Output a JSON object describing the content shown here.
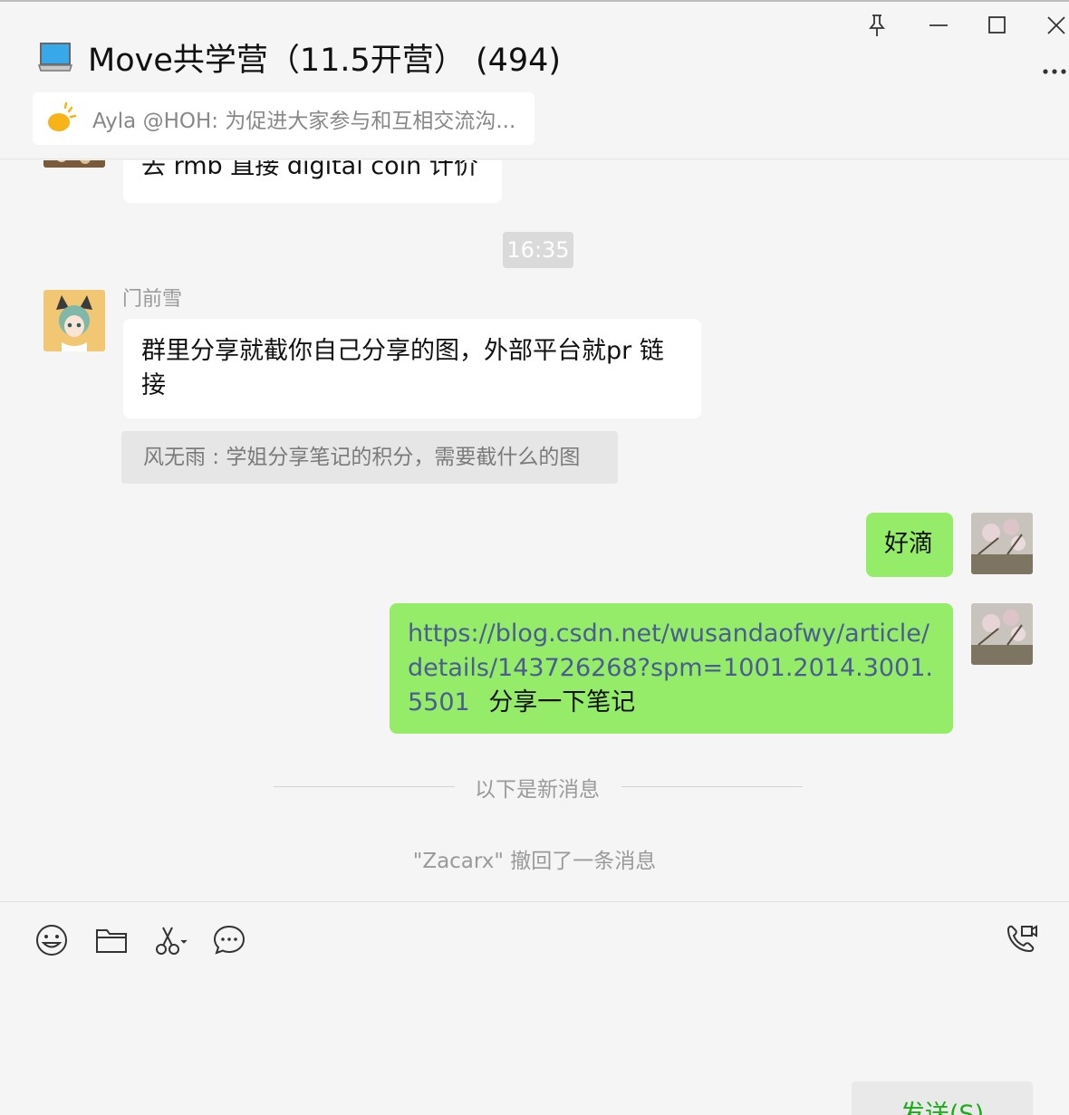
{
  "window": {
    "title": "Move共学营（11.5开营）",
    "member_count": "(494)"
  },
  "notice": {
    "text": "Ayla @HOH: 为促进大家参与和互相交流沟..."
  },
  "messages": {
    "partial_message": "去 rmb 直接 digital coin 计价",
    "timestamp": "16:35",
    "sender_name": "门前雪",
    "incoming_text": "群里分享就截你自己分享的图，外部平台就pr 链接",
    "quote": "风无雨 : 学姐分享笔记的积分，需要截什么的图",
    "outgoing_1": "好滴",
    "outgoing_2_link": "https://blog.csdn.net/wusandaofwy/article/details/143726268?spm=1001.2014.3001.5501",
    "outgoing_2_suffix": "分享一下笔记",
    "new_messages_divider": "以下是新消息",
    "recall_notice": "\"Zacarx\" 撤回了一条消息"
  },
  "composer": {
    "send_label": "发送(S)"
  },
  "colors": {
    "background": "#f5f5f5",
    "bubble_outgoing": "#95ec69",
    "bubble_incoming": "#ffffff",
    "send_text": "#1aad19",
    "link": "#4a5d91"
  },
  "icons": {
    "title_icon": "laptop-icon",
    "notice_icon": "announcement-icon",
    "toolbar": [
      "emoji-icon",
      "folder-icon",
      "scissors-icon",
      "chat-history-icon"
    ],
    "call_icon": "voice-video-call-icon"
  }
}
